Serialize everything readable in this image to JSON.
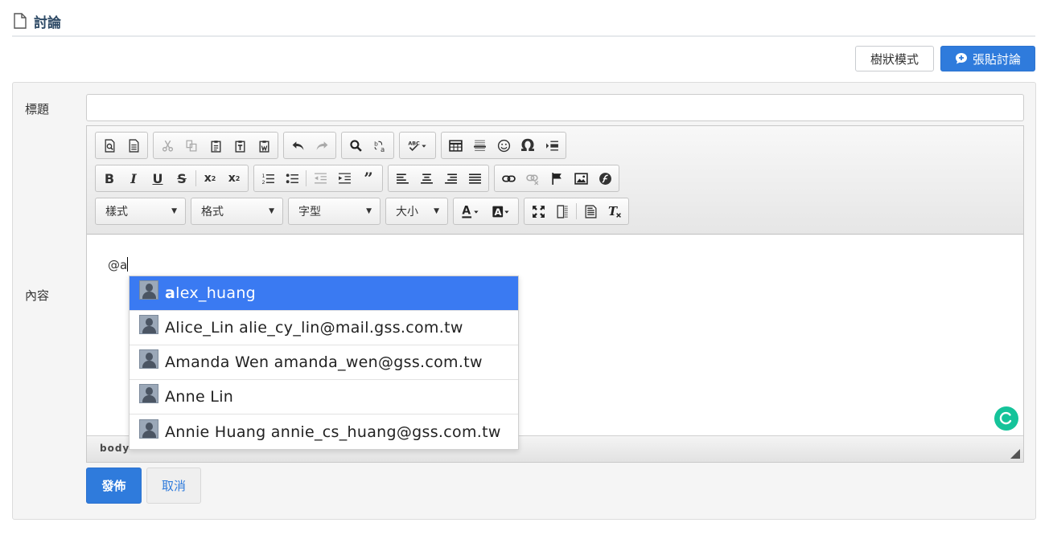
{
  "page": {
    "title": "討論"
  },
  "actions": {
    "tree_mode": "樹狀模式",
    "post_discussion": "張貼討論"
  },
  "form": {
    "title_label": "標題",
    "title_value": "",
    "content_label": "內容",
    "publish": "發佈",
    "cancel": "取消"
  },
  "editor": {
    "content_text": "@a",
    "status_path": "body",
    "combos": {
      "styles": "樣式",
      "format": "格式",
      "font": "字型",
      "size": "大小"
    },
    "toolbar_icons": {
      "row1": [
        "preview-icon",
        "templates-icon",
        "cut-icon",
        "copy-icon",
        "paste-icon",
        "paste-text-icon",
        "paste-word-icon",
        "undo-icon",
        "redo-icon",
        "find-icon",
        "replace-icon",
        "spellcheck-icon",
        "table-icon",
        "horizontal-line-icon",
        "smiley-icon",
        "special-char-icon",
        "page-break-icon"
      ],
      "row2": [
        "bold-icon",
        "italic-icon",
        "underline-icon",
        "strikethrough-icon",
        "subscript-icon",
        "superscript-icon",
        "numbered-list-icon",
        "bulleted-list-icon",
        "outdent-icon",
        "indent-icon",
        "blockquote-icon",
        "align-left-icon",
        "align-center-icon",
        "align-right-icon",
        "justify-icon",
        "link-icon",
        "unlink-icon",
        "anchor-icon",
        "image-icon",
        "flash-icon"
      ],
      "row3": [
        "text-color-icon",
        "background-color-icon",
        "maximize-icon",
        "show-blocks-icon",
        "source-icon",
        "remove-format-icon"
      ]
    }
  },
  "mention": {
    "items": [
      {
        "highlight": "a",
        "rest": "lex_huang"
      },
      {
        "highlight": "",
        "rest": "Alice_Lin alie_cy_lin@mail.gss.com.tw"
      },
      {
        "highlight": "",
        "rest": "Amanda Wen amanda_wen@gss.com.tw"
      },
      {
        "highlight": "",
        "rest": "Anne Lin"
      },
      {
        "highlight": "",
        "rest": "Annie Huang annie_cs_huang@gss.com.tw"
      }
    ]
  },
  "colors": {
    "primary": "#2f7bdc",
    "mention_active": "#3a7af2",
    "grammarly": "#15c39a",
    "header_text": "#2e4a66"
  }
}
